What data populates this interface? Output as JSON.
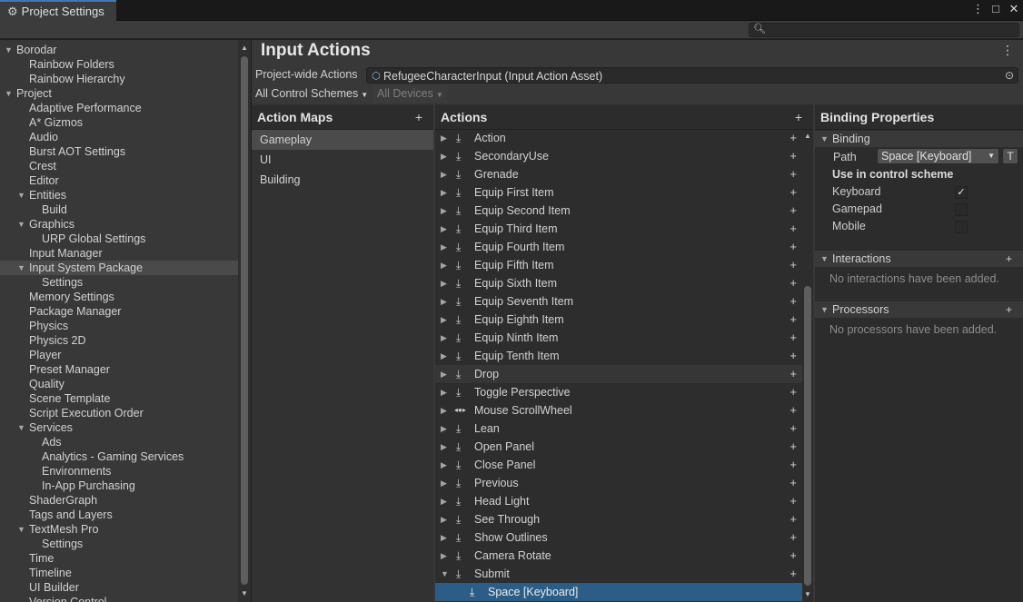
{
  "window": {
    "tab_title": "Project Settings",
    "controls": [
      "⋮",
      "□",
      "✕"
    ]
  },
  "search": {
    "placeholder": "",
    "value": ""
  },
  "sidebar": {
    "items": [
      {
        "label": "Borodar",
        "indent": 0,
        "arrow": "down"
      },
      {
        "label": "Rainbow Folders",
        "indent": 1,
        "arrow": ""
      },
      {
        "label": "Rainbow Hierarchy",
        "indent": 1,
        "arrow": ""
      },
      {
        "label": "Project",
        "indent": 0,
        "arrow": "down"
      },
      {
        "label": "Adaptive Performance",
        "indent": 1,
        "arrow": ""
      },
      {
        "label": "A* Gizmos",
        "indent": 1,
        "arrow": ""
      },
      {
        "label": "Audio",
        "indent": 1,
        "arrow": ""
      },
      {
        "label": "Burst AOT Settings",
        "indent": 1,
        "arrow": ""
      },
      {
        "label": "Crest",
        "indent": 1,
        "arrow": ""
      },
      {
        "label": "Editor",
        "indent": 1,
        "arrow": ""
      },
      {
        "label": "Entities",
        "indent": 1,
        "arrow": "down"
      },
      {
        "label": "Build",
        "indent": 2,
        "arrow": ""
      },
      {
        "label": "Graphics",
        "indent": 1,
        "arrow": "down"
      },
      {
        "label": "URP Global Settings",
        "indent": 2,
        "arrow": ""
      },
      {
        "label": "Input Manager",
        "indent": 1,
        "arrow": ""
      },
      {
        "label": "Input System Package",
        "indent": 1,
        "arrow": "down",
        "selected": true
      },
      {
        "label": "Settings",
        "indent": 2,
        "arrow": ""
      },
      {
        "label": "Memory Settings",
        "indent": 1,
        "arrow": ""
      },
      {
        "label": "Package Manager",
        "indent": 1,
        "arrow": ""
      },
      {
        "label": "Physics",
        "indent": 1,
        "arrow": ""
      },
      {
        "label": "Physics 2D",
        "indent": 1,
        "arrow": ""
      },
      {
        "label": "Player",
        "indent": 1,
        "arrow": ""
      },
      {
        "label": "Preset Manager",
        "indent": 1,
        "arrow": ""
      },
      {
        "label": "Quality",
        "indent": 1,
        "arrow": ""
      },
      {
        "label": "Scene Template",
        "indent": 1,
        "arrow": ""
      },
      {
        "label": "Script Execution Order",
        "indent": 1,
        "arrow": ""
      },
      {
        "label": "Services",
        "indent": 1,
        "arrow": "down"
      },
      {
        "label": "Ads",
        "indent": 2,
        "arrow": ""
      },
      {
        "label": "Analytics - Gaming Services",
        "indent": 2,
        "arrow": ""
      },
      {
        "label": "Environments",
        "indent": 2,
        "arrow": ""
      },
      {
        "label": "In-App Purchasing",
        "indent": 2,
        "arrow": ""
      },
      {
        "label": "ShaderGraph",
        "indent": 1,
        "arrow": ""
      },
      {
        "label": "Tags and Layers",
        "indent": 1,
        "arrow": ""
      },
      {
        "label": "TextMesh Pro",
        "indent": 1,
        "arrow": "down"
      },
      {
        "label": "Settings",
        "indent": 2,
        "arrow": ""
      },
      {
        "label": "Time",
        "indent": 1,
        "arrow": ""
      },
      {
        "label": "Timeline",
        "indent": 1,
        "arrow": ""
      },
      {
        "label": "UI Builder",
        "indent": 1,
        "arrow": ""
      },
      {
        "label": "Version Control",
        "indent": 1,
        "arrow": ""
      }
    ]
  },
  "main": {
    "title": "Input Actions",
    "project_wide_label": "Project-wide Actions",
    "asset_value": "RefugeeCharacterInput (Input Action Asset)",
    "control_schemes": "All Control Schemes",
    "devices": "All Devices"
  },
  "action_maps": {
    "title": "Action Maps",
    "add": "+",
    "items": [
      "Gameplay",
      "UI",
      "Building"
    ],
    "selected": 0
  },
  "actions": {
    "title": "Actions",
    "add": "+",
    "items": [
      {
        "label": "Action",
        "icon": "button"
      },
      {
        "label": "SecondaryUse",
        "icon": "button"
      },
      {
        "label": "Grenade",
        "icon": "button"
      },
      {
        "label": "Equip First Item",
        "icon": "button"
      },
      {
        "label": "Equip Second Item",
        "icon": "button"
      },
      {
        "label": "Equip Third Item",
        "icon": "button"
      },
      {
        "label": "Equip Fourth Item",
        "icon": "button"
      },
      {
        "label": "Equip Fifth Item",
        "icon": "button"
      },
      {
        "label": "Equip Sixth Item",
        "icon": "button"
      },
      {
        "label": "Equip Seventh Item",
        "icon": "button"
      },
      {
        "label": "Equip Eighth Item",
        "icon": "button"
      },
      {
        "label": "Equip Ninth Item",
        "icon": "button"
      },
      {
        "label": "Equip Tenth Item",
        "icon": "button"
      },
      {
        "label": "Drop",
        "icon": "button",
        "highlight": true
      },
      {
        "label": "Toggle Perspective",
        "icon": "button"
      },
      {
        "label": "Mouse ScrollWheel",
        "icon": "axis"
      },
      {
        "label": "Lean",
        "icon": "button"
      },
      {
        "label": "Open Panel",
        "icon": "button"
      },
      {
        "label": "Close Panel",
        "icon": "button"
      },
      {
        "label": "Previous",
        "icon": "button"
      },
      {
        "label": "Head Light",
        "icon": "button"
      },
      {
        "label": "See Through",
        "icon": "button"
      },
      {
        "label": "Show Outlines",
        "icon": "button"
      },
      {
        "label": "Camera Rotate",
        "icon": "button"
      },
      {
        "label": "Submit",
        "icon": "button",
        "expanded": true
      }
    ],
    "selected_binding": "Space [Keyboard]"
  },
  "binding_properties": {
    "title": "Binding Properties",
    "binding_section": "Binding",
    "path_label": "Path",
    "path_value": "Space [Keyboard]",
    "t_button": "T",
    "use_in_scheme": "Use in control scheme",
    "schemes": [
      {
        "label": "Keyboard",
        "checked": true
      },
      {
        "label": "Gamepad",
        "checked": false
      },
      {
        "label": "Mobile",
        "checked": false
      }
    ],
    "interactions_section": "Interactions",
    "interactions_empty": "No interactions have been added.",
    "processors_section": "Processors",
    "processors_empty": "No processors have been added.",
    "add": "+"
  }
}
